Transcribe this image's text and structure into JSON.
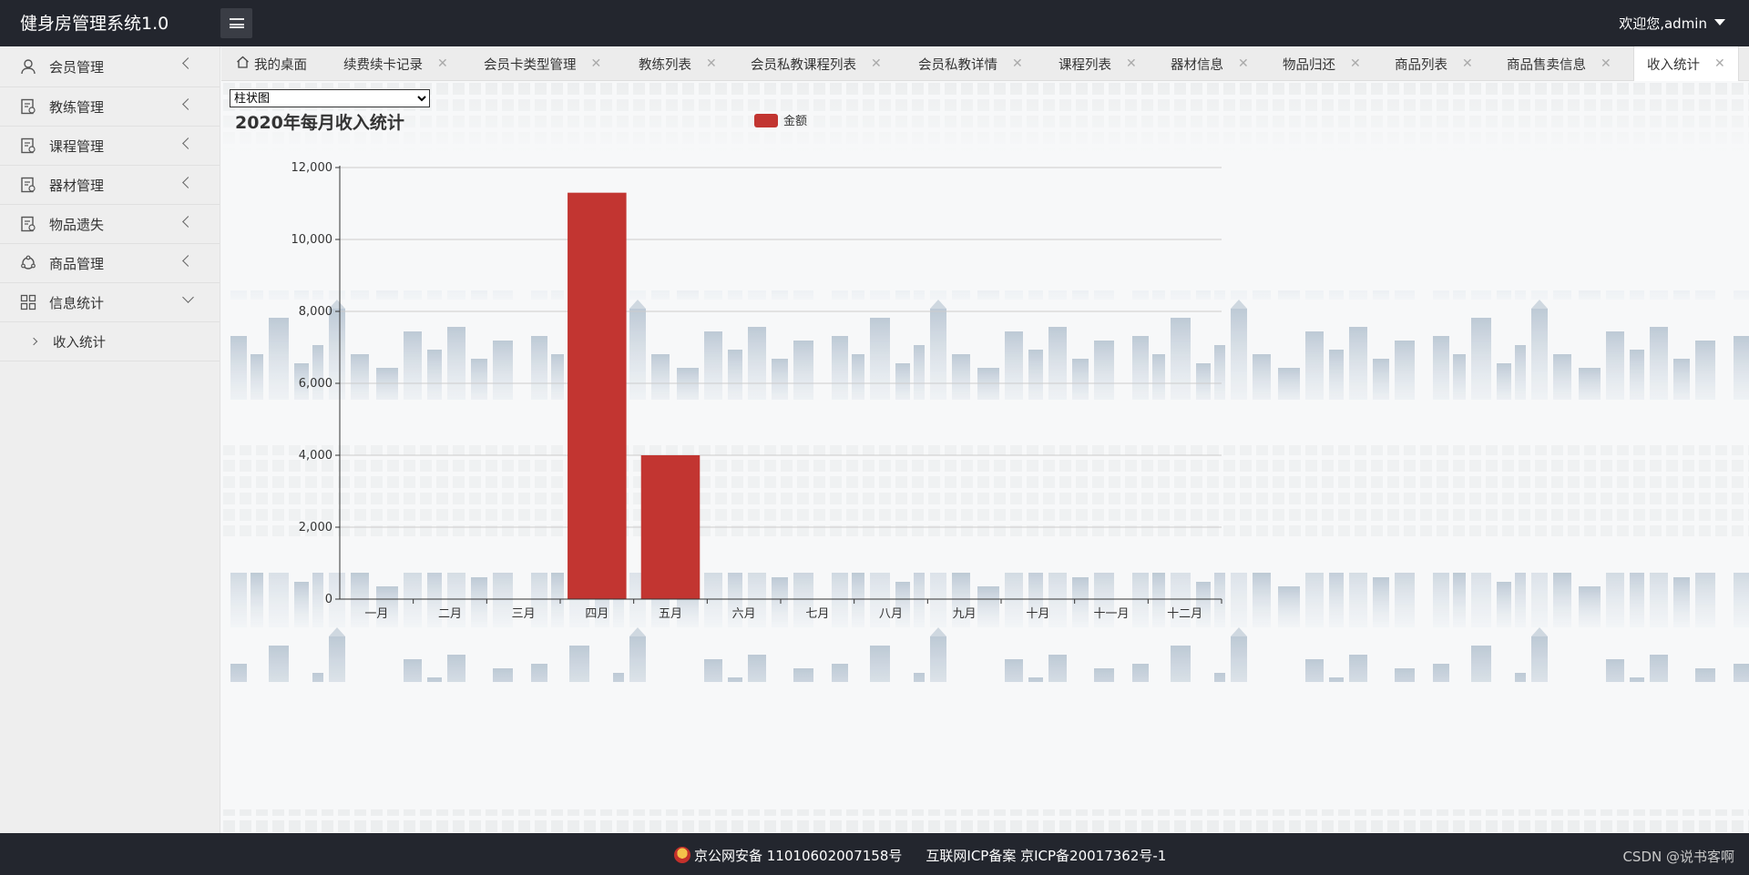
{
  "header": {
    "title": "健身房管理系统1.0",
    "user_label": "欢迎您,admin"
  },
  "sidebar": {
    "items": [
      {
        "label": "会员管理",
        "icon": "user-icon"
      },
      {
        "label": "教练管理",
        "icon": "form-icon"
      },
      {
        "label": "课程管理",
        "icon": "form-icon"
      },
      {
        "label": "器材管理",
        "icon": "form-icon"
      },
      {
        "label": "物品遗失",
        "icon": "form-icon"
      },
      {
        "label": "商品管理",
        "icon": "circle-nodes-icon"
      },
      {
        "label": "信息统计",
        "icon": "grid-icon"
      }
    ],
    "sub_item": {
      "label": "收入统计"
    }
  },
  "tabs": [
    {
      "label": "我的桌面"
    },
    {
      "label": "续费续卡记录"
    },
    {
      "label": "会员卡类型管理"
    },
    {
      "label": "教练列表"
    },
    {
      "label": "会员私教课程列表"
    },
    {
      "label": "会员私教详情"
    },
    {
      "label": "课程列表"
    },
    {
      "label": "器材信息"
    },
    {
      "label": "物品归还"
    },
    {
      "label": "商品列表"
    },
    {
      "label": "商品售卖信息"
    },
    {
      "label": "收入统计"
    }
  ],
  "chart_select": {
    "value": "柱状图",
    "options": [
      "柱状图"
    ]
  },
  "chart_data": {
    "type": "bar",
    "title": "2020年每月收入统计",
    "legend": [
      "金额"
    ],
    "legend_position": "top-center",
    "categories": [
      "一月",
      "二月",
      "三月",
      "四月",
      "五月",
      "六月",
      "七月",
      "八月",
      "九月",
      "十月",
      "十一月",
      "十二月"
    ],
    "series": [
      {
        "name": "金额",
        "values": [
          0,
          0,
          0,
          11300,
          4000,
          0,
          0,
          0,
          0,
          0,
          0,
          0
        ]
      }
    ],
    "ylim": [
      0,
      12000
    ],
    "yticks": [
      "0",
      "2,000",
      "4,000",
      "6,000",
      "8,000",
      "10,000",
      "12,000"
    ],
    "grid": true,
    "color": "#c23531"
  },
  "footer": {
    "police_label": "京公网安备 11010602007158号",
    "icp_label": "互联网ICP备案 京ICP备20017362号-1",
    "watermark": "CSDN @说书客啊"
  }
}
